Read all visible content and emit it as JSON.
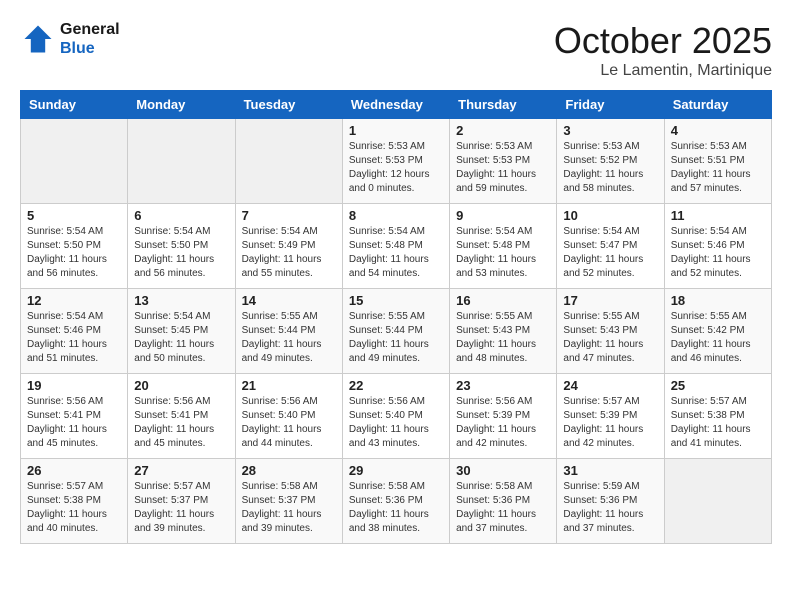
{
  "header": {
    "logo_line1": "General",
    "logo_line2": "Blue",
    "title": "October 2025",
    "subtitle": "Le Lamentin, Martinique"
  },
  "weekdays": [
    "Sunday",
    "Monday",
    "Tuesday",
    "Wednesday",
    "Thursday",
    "Friday",
    "Saturday"
  ],
  "weeks": [
    [
      {
        "day": "",
        "info": ""
      },
      {
        "day": "",
        "info": ""
      },
      {
        "day": "",
        "info": ""
      },
      {
        "day": "1",
        "info": "Sunrise: 5:53 AM\nSunset: 5:53 PM\nDaylight: 12 hours\nand 0 minutes."
      },
      {
        "day": "2",
        "info": "Sunrise: 5:53 AM\nSunset: 5:53 PM\nDaylight: 11 hours\nand 59 minutes."
      },
      {
        "day": "3",
        "info": "Sunrise: 5:53 AM\nSunset: 5:52 PM\nDaylight: 11 hours\nand 58 minutes."
      },
      {
        "day": "4",
        "info": "Sunrise: 5:53 AM\nSunset: 5:51 PM\nDaylight: 11 hours\nand 57 minutes."
      }
    ],
    [
      {
        "day": "5",
        "info": "Sunrise: 5:54 AM\nSunset: 5:50 PM\nDaylight: 11 hours\nand 56 minutes."
      },
      {
        "day": "6",
        "info": "Sunrise: 5:54 AM\nSunset: 5:50 PM\nDaylight: 11 hours\nand 56 minutes."
      },
      {
        "day": "7",
        "info": "Sunrise: 5:54 AM\nSunset: 5:49 PM\nDaylight: 11 hours\nand 55 minutes."
      },
      {
        "day": "8",
        "info": "Sunrise: 5:54 AM\nSunset: 5:48 PM\nDaylight: 11 hours\nand 54 minutes."
      },
      {
        "day": "9",
        "info": "Sunrise: 5:54 AM\nSunset: 5:48 PM\nDaylight: 11 hours\nand 53 minutes."
      },
      {
        "day": "10",
        "info": "Sunrise: 5:54 AM\nSunset: 5:47 PM\nDaylight: 11 hours\nand 52 minutes."
      },
      {
        "day": "11",
        "info": "Sunrise: 5:54 AM\nSunset: 5:46 PM\nDaylight: 11 hours\nand 52 minutes."
      }
    ],
    [
      {
        "day": "12",
        "info": "Sunrise: 5:54 AM\nSunset: 5:46 PM\nDaylight: 11 hours\nand 51 minutes."
      },
      {
        "day": "13",
        "info": "Sunrise: 5:54 AM\nSunset: 5:45 PM\nDaylight: 11 hours\nand 50 minutes."
      },
      {
        "day": "14",
        "info": "Sunrise: 5:55 AM\nSunset: 5:44 PM\nDaylight: 11 hours\nand 49 minutes."
      },
      {
        "day": "15",
        "info": "Sunrise: 5:55 AM\nSunset: 5:44 PM\nDaylight: 11 hours\nand 49 minutes."
      },
      {
        "day": "16",
        "info": "Sunrise: 5:55 AM\nSunset: 5:43 PM\nDaylight: 11 hours\nand 48 minutes."
      },
      {
        "day": "17",
        "info": "Sunrise: 5:55 AM\nSunset: 5:43 PM\nDaylight: 11 hours\nand 47 minutes."
      },
      {
        "day": "18",
        "info": "Sunrise: 5:55 AM\nSunset: 5:42 PM\nDaylight: 11 hours\nand 46 minutes."
      }
    ],
    [
      {
        "day": "19",
        "info": "Sunrise: 5:56 AM\nSunset: 5:41 PM\nDaylight: 11 hours\nand 45 minutes."
      },
      {
        "day": "20",
        "info": "Sunrise: 5:56 AM\nSunset: 5:41 PM\nDaylight: 11 hours\nand 45 minutes."
      },
      {
        "day": "21",
        "info": "Sunrise: 5:56 AM\nSunset: 5:40 PM\nDaylight: 11 hours\nand 44 minutes."
      },
      {
        "day": "22",
        "info": "Sunrise: 5:56 AM\nSunset: 5:40 PM\nDaylight: 11 hours\nand 43 minutes."
      },
      {
        "day": "23",
        "info": "Sunrise: 5:56 AM\nSunset: 5:39 PM\nDaylight: 11 hours\nand 42 minutes."
      },
      {
        "day": "24",
        "info": "Sunrise: 5:57 AM\nSunset: 5:39 PM\nDaylight: 11 hours\nand 42 minutes."
      },
      {
        "day": "25",
        "info": "Sunrise: 5:57 AM\nSunset: 5:38 PM\nDaylight: 11 hours\nand 41 minutes."
      }
    ],
    [
      {
        "day": "26",
        "info": "Sunrise: 5:57 AM\nSunset: 5:38 PM\nDaylight: 11 hours\nand 40 minutes."
      },
      {
        "day": "27",
        "info": "Sunrise: 5:57 AM\nSunset: 5:37 PM\nDaylight: 11 hours\nand 39 minutes."
      },
      {
        "day": "28",
        "info": "Sunrise: 5:58 AM\nSunset: 5:37 PM\nDaylight: 11 hours\nand 39 minutes."
      },
      {
        "day": "29",
        "info": "Sunrise: 5:58 AM\nSunset: 5:36 PM\nDaylight: 11 hours\nand 38 minutes."
      },
      {
        "day": "30",
        "info": "Sunrise: 5:58 AM\nSunset: 5:36 PM\nDaylight: 11 hours\nand 37 minutes."
      },
      {
        "day": "31",
        "info": "Sunrise: 5:59 AM\nSunset: 5:36 PM\nDaylight: 11 hours\nand 37 minutes."
      },
      {
        "day": "",
        "info": ""
      }
    ]
  ]
}
